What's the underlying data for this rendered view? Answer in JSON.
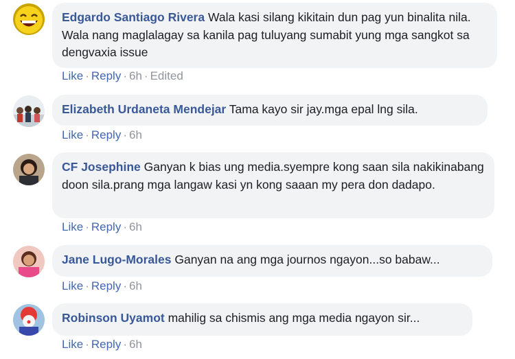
{
  "comments": [
    {
      "author": "Edgardo Santiago Rivera",
      "text": "Wala kasi silang kikitain dun pag yun binalita nila. Wala nang maglalagay sa kanila pag tuluyang sumabit yung mga sangkot sa dengvaxia issue",
      "like": "Like",
      "reply": "Reply",
      "time": "6h",
      "edited": "Edited",
      "avatar_icon": "laughing-face-avatar"
    },
    {
      "author": "Elizabeth Urdaneta Mendejar",
      "text": "Tama kayo sir jay.mga epal lng sila.",
      "like": "Like",
      "reply": "Reply",
      "time": "6h",
      "avatar_icon": "group-photo-avatar"
    },
    {
      "author": "CF Josephine",
      "text": "Ganyan k bias ung media.syempre kong saan sila nakikinabang doon sila.prang mga langaw kasi yn kong saaan my pera don dadapo.",
      "like": "Like",
      "reply": "Reply",
      "time": "6h",
      "avatar_icon": "woman-photo-avatar"
    },
    {
      "author": "Jane Lugo-Morales",
      "text": "Ganyan na ang mga journos ngayon...so babaw...",
      "like": "Like",
      "reply": "Reply",
      "time": "6h",
      "avatar_icon": "woman-pink-photo-avatar"
    },
    {
      "author": "Robinson Uyamot",
      "text": "mahilig sa chismis ang mga media ngayon sir...",
      "like": "Like",
      "reply": "Reply",
      "time": "6h",
      "avatar_icon": "clown-avatar"
    }
  ],
  "colors": {
    "author": "#385898",
    "bubble": "#f2f3f5",
    "action_link": "#4267b2",
    "meta": "#90949c"
  }
}
